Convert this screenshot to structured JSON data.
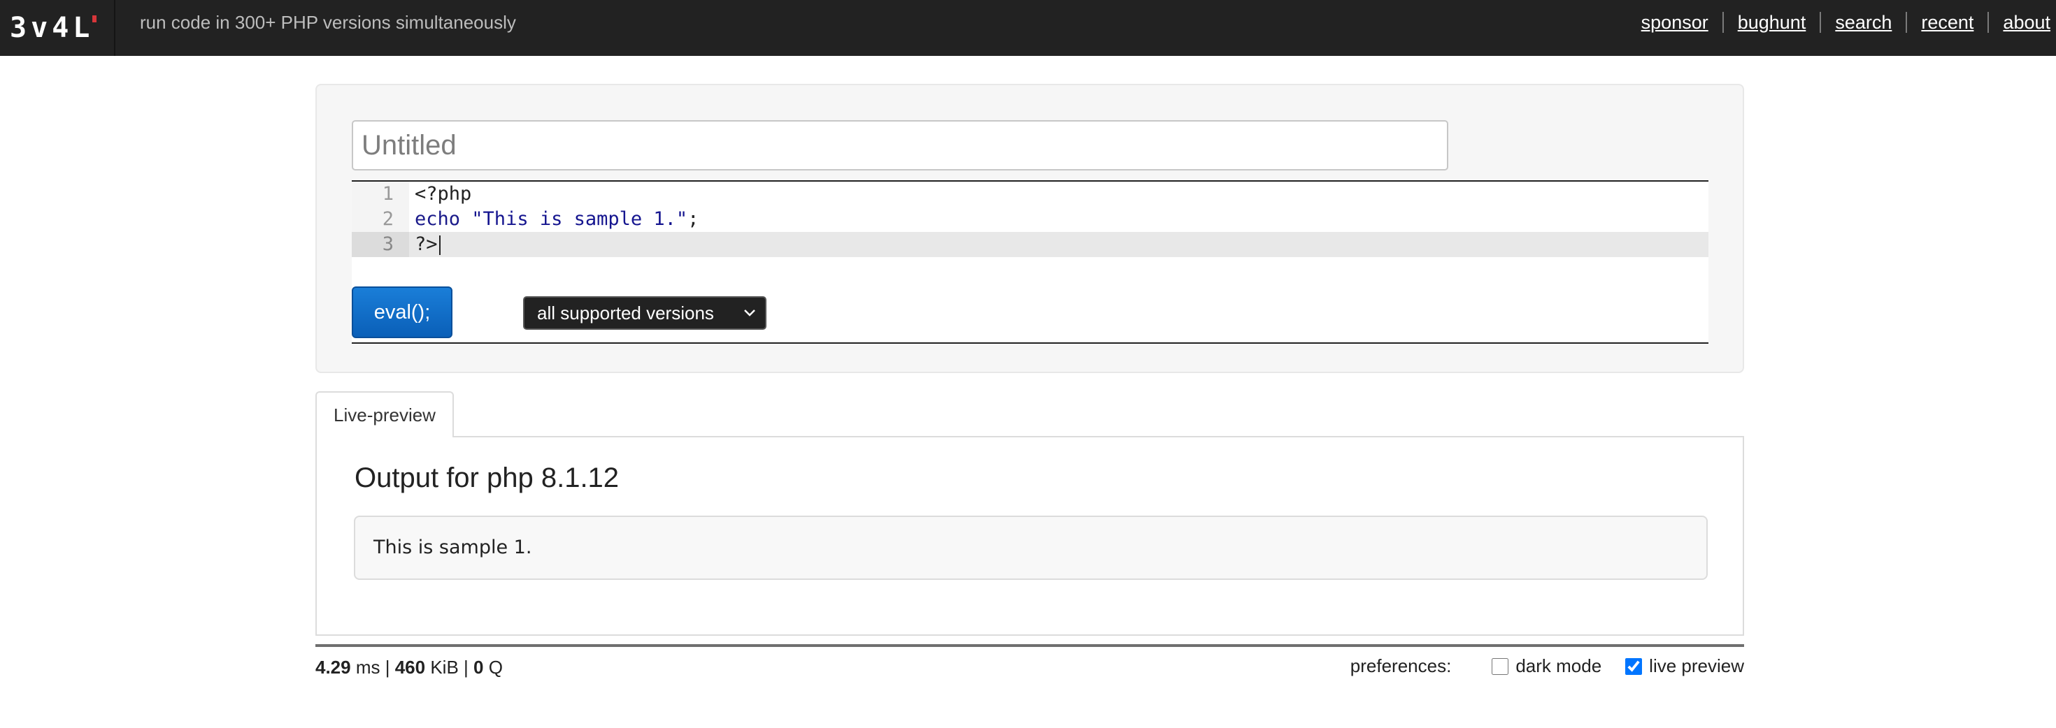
{
  "header": {
    "logo_letters": [
      "3",
      "v",
      "4",
      "L"
    ],
    "tagline": "run code in 300+ PHP versions simultaneously",
    "nav": [
      {
        "label": "sponsor"
      },
      {
        "label": "bughunt"
      },
      {
        "label": "search"
      },
      {
        "label": "recent"
      },
      {
        "label": "about"
      }
    ]
  },
  "editor": {
    "title_placeholder": "Untitled",
    "title_value": "",
    "lines": [
      {
        "number": "1",
        "text": "<?php"
      },
      {
        "number": "2",
        "keyword": "echo",
        "string": "\"This is sample 1.\"",
        "tail": ";"
      },
      {
        "number": "3",
        "text": "?>"
      }
    ],
    "eval_label": "eval();",
    "version_selected": "all supported versions",
    "version_chevron_icon": "chevron-down-icon"
  },
  "output": {
    "tab_label": "Live-preview",
    "title": "Output for php 8.1.12",
    "result": "This is sample 1."
  },
  "footer": {
    "time_value": "4.29",
    "time_unit": "ms",
    "mem_value": "460",
    "mem_unit": "KiB",
    "queries_value": "0",
    "queries_unit": "Q",
    "preferences_label": "preferences:",
    "dark_mode_label": "dark mode",
    "dark_mode_checked": false,
    "live_preview_label": "live preview",
    "live_preview_checked": true
  },
  "colors": {
    "header_bg": "#222222",
    "accent_red": "#d8363a",
    "eval_button": "#0a6fd0",
    "panel_bg": "#f6f6f6"
  }
}
